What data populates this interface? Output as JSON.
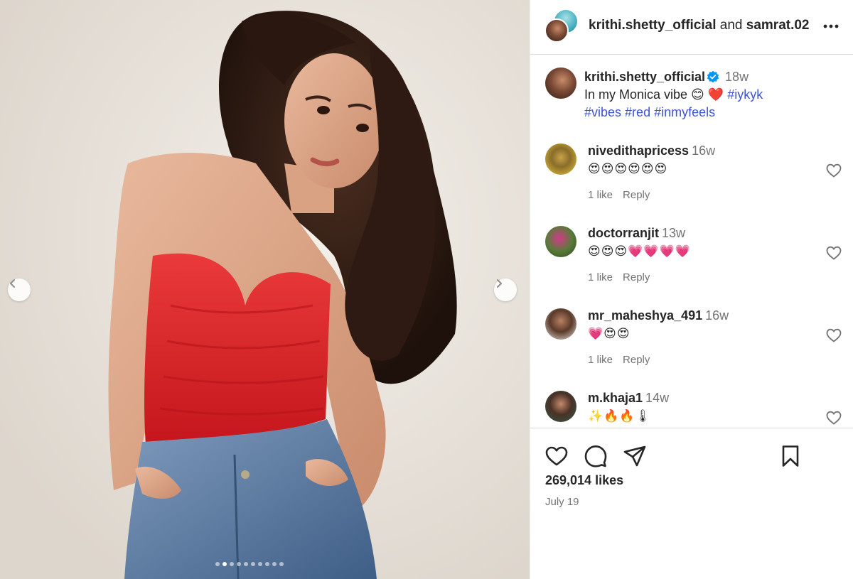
{
  "header": {
    "user1": "krithi.shetty_official",
    "conj": "and",
    "user2": "samrat.02",
    "more_icon": "more-horizontal-icon"
  },
  "caption": {
    "username": "krithi.shetty_official",
    "time": "18w",
    "text": "In my Monica vibe 😊 ❤️",
    "hashtags": [
      "#iykyk",
      "#vibes",
      "#red",
      "#inmyfeels"
    ]
  },
  "comments": [
    {
      "username": "niveditha​pricess",
      "time": "16w",
      "text": "😍😍😍😍😍😍",
      "likes": "1 like",
      "reply": "Reply"
    },
    {
      "username": "doctorranjit",
      "time": "13w",
      "text": "😍😍😍💗💗💗💗",
      "likes": "1 like",
      "reply": "Reply"
    },
    {
      "username": "mr_maheshya_491",
      "time": "16w",
      "text": "💗😍😍",
      "likes": "1 like",
      "reply": "Reply"
    },
    {
      "username": "m.khaja1",
      "time": "14w",
      "text": "✨🔥🔥🌡",
      "likes": "",
      "reply": ""
    }
  ],
  "footer": {
    "likes": "269,014 likes",
    "date": "July 19"
  },
  "carousel": {
    "total": 10,
    "active_index": 1
  },
  "colors": {
    "accent_link": "#3e55d1",
    "verified": "#0095f6",
    "muted": "#737373",
    "top_red": "#e02a2f",
    "denim": "#4a6a92"
  }
}
